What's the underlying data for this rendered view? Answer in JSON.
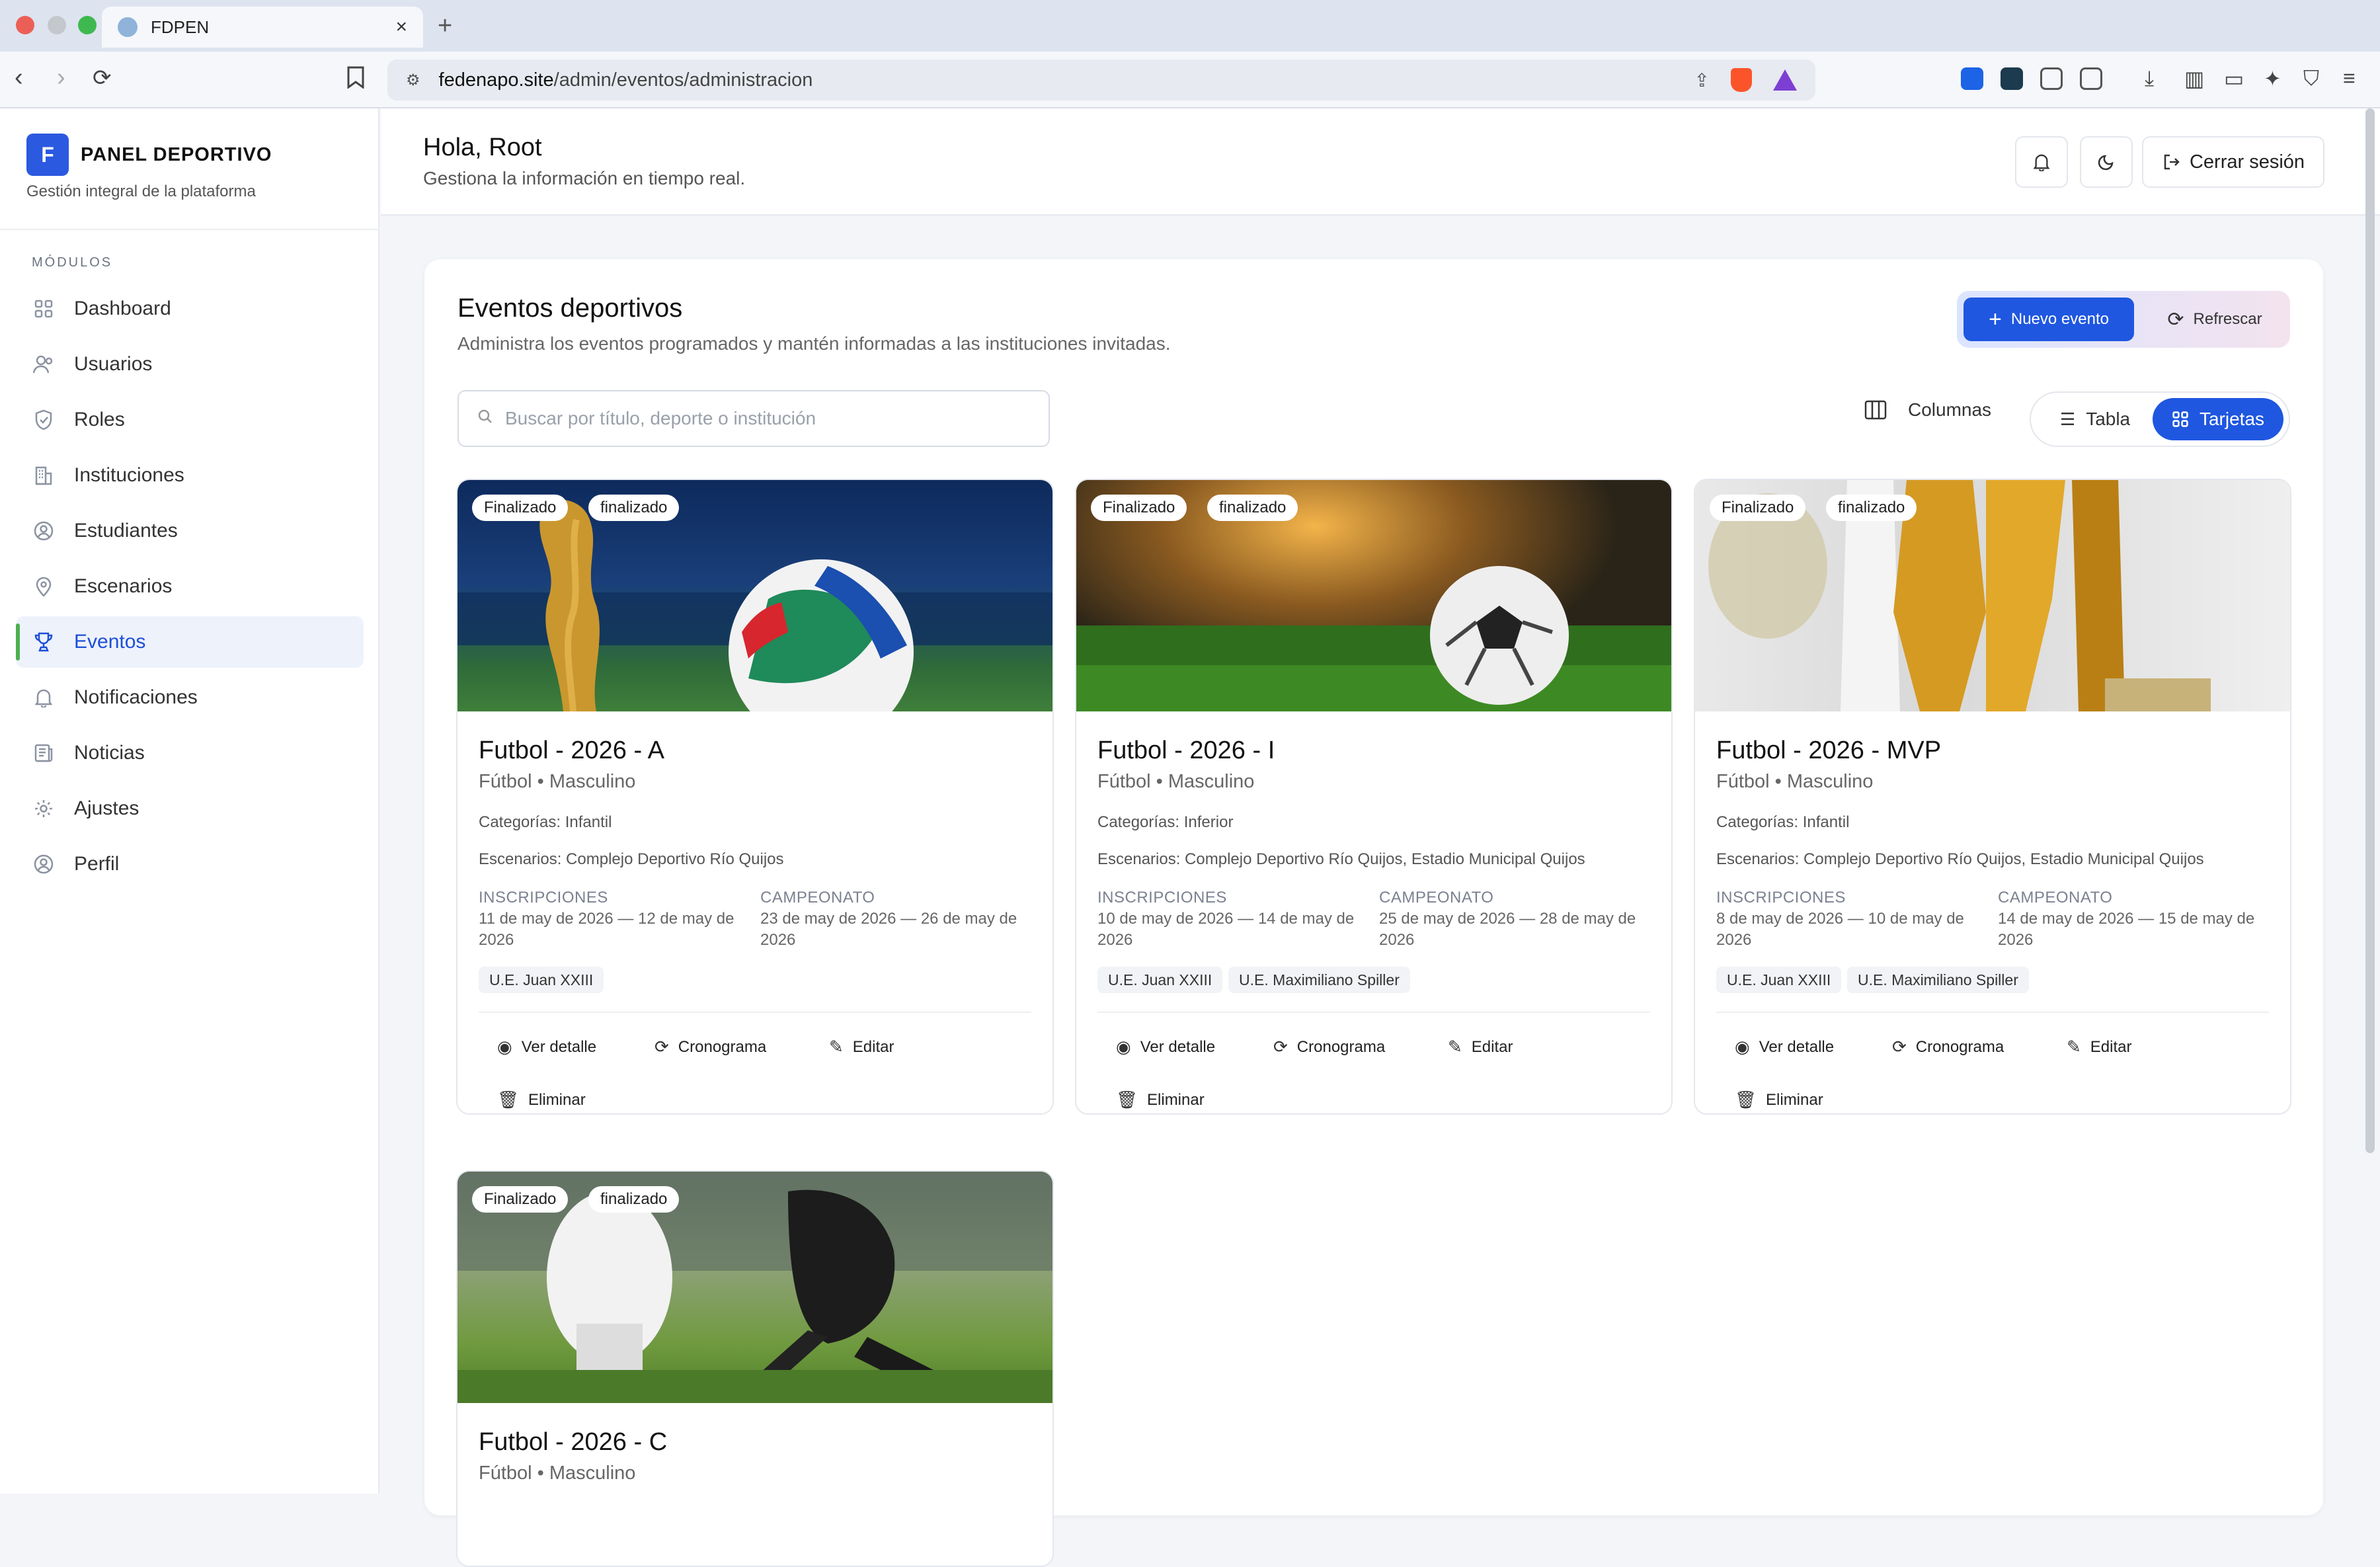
{
  "browser": {
    "tab_title": "FDPEN",
    "url_host": "fedenapo.site",
    "url_path": "/admin/eventos/administracion"
  },
  "sidebar": {
    "brand_letter": "F",
    "brand_name": "PANEL DEPORTIVO",
    "brand_sub": "Gestión integral de la plataforma",
    "modules_label": "MÓDULOS",
    "items": [
      {
        "label": "Dashboard",
        "icon": "grid-icon"
      },
      {
        "label": "Usuarios",
        "icon": "users-icon"
      },
      {
        "label": "Roles",
        "icon": "shield-icon"
      },
      {
        "label": "Instituciones",
        "icon": "building-icon"
      },
      {
        "label": "Estudiantes",
        "icon": "user-circle-icon"
      },
      {
        "label": "Escenarios",
        "icon": "map-pin-icon"
      },
      {
        "label": "Eventos",
        "icon": "trophy-icon",
        "active": true
      },
      {
        "label": "Notificaciones",
        "icon": "bell-icon"
      },
      {
        "label": "Noticias",
        "icon": "newspaper-icon"
      },
      {
        "label": "Ajustes",
        "icon": "gear-icon"
      },
      {
        "label": "Perfil",
        "icon": "user-circle-icon"
      }
    ]
  },
  "header": {
    "greeting": "Hola, Root",
    "subtitle": "Gestiona la información en tiempo real.",
    "logout_label": "Cerrar sesión"
  },
  "main": {
    "title": "Eventos deportivos",
    "subtitle": "Administra los eventos programados y mantén informadas a las instituciones invitadas.",
    "new_event_label": "Nuevo evento",
    "refresh_label": "Refrescar",
    "search_placeholder": "Buscar por título, deporte o institución",
    "columns_label": "Columnas",
    "view_table_label": "Tabla",
    "view_cards_label": "Tarjetas",
    "labels": {
      "inscripciones": "INSCRIPCIONES",
      "campeonato": "CAMPEONATO",
      "ver_detalle": "Ver detalle",
      "cronograma": "Cronograma",
      "editar": "Editar",
      "eliminar": "Eliminar"
    },
    "events": [
      {
        "badge1": "Finalizado",
        "badge2": "finalizado",
        "title": "Futbol - 2026 - A",
        "sport": "Fútbol • Masculino",
        "categories": "Categorías: Infantil",
        "venues": "Escenarios: Complejo Deportivo Río Quijos",
        "inscripciones": "11 de may de 2026 — 12 de may de 2026",
        "campeonato": "23 de may de 2026 — 26 de may de 2026",
        "institutions": [
          "U.E. Juan XXIII"
        ]
      },
      {
        "badge1": "Finalizado",
        "badge2": "finalizado",
        "title": "Futbol - 2026 - I",
        "sport": "Fútbol • Masculino",
        "categories": "Categorías: Inferior",
        "venues": "Escenarios: Complejo Deportivo Río Quijos, Estadio Municipal Quijos",
        "inscripciones": "10 de may de 2026 — 14 de may de 2026",
        "campeonato": "25 de may de 2026 — 28 de may de 2026",
        "institutions": [
          "U.E. Juan XXIII",
          "U.E. Maximiliano Spiller"
        ]
      },
      {
        "badge1": "Finalizado",
        "badge2": "finalizado",
        "title": "Futbol - 2026 - MVP",
        "sport": "Fútbol • Masculino",
        "categories": "Categorías: Infantil",
        "venues": "Escenarios: Complejo Deportivo Río Quijos, Estadio Municipal Quijos",
        "inscripciones": "8 de may de 2026 — 10 de may de 2026",
        "campeonato": "14 de may de 2026 — 15 de may de 2026",
        "institutions": [
          "U.E. Juan XXIII",
          "U.E. Maximiliano Spiller"
        ]
      },
      {
        "badge1": "Finalizado",
        "badge2": "finalizado",
        "title": "Futbol - 2026 - C",
        "sport": "Fútbol • Masculino"
      }
    ]
  },
  "colors": {
    "accent": "#1f57e0",
    "active_indicator": "#4caf50",
    "sidebar_active_bg": "#eef2fb"
  }
}
